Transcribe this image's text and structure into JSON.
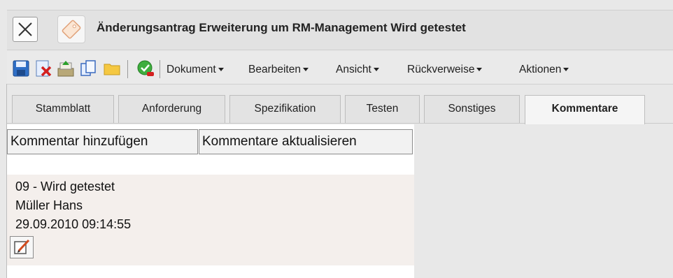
{
  "window": {
    "title": "Änderungsantrag Erweiterung um RM-Management Wird getestet",
    "close_icon": "close-icon",
    "document_icon": "tag-icon"
  },
  "toolbar": {
    "icons": [
      "save-icon",
      "delete-icon",
      "export-icon",
      "copy-icon",
      "folder-icon",
      "approve-icon"
    ],
    "menus": [
      {
        "label": "Dokument"
      },
      {
        "label": "Bearbeiten"
      },
      {
        "label": "Ansicht"
      },
      {
        "label": "Rückverweise"
      },
      {
        "label": "Aktionen"
      }
    ]
  },
  "tabs": [
    {
      "label": "Stammblatt",
      "active": false
    },
    {
      "label": "Anforderung",
      "active": false
    },
    {
      "label": "Spezifikation",
      "active": false
    },
    {
      "label": "Testen",
      "active": false
    },
    {
      "label": "Sonstiges",
      "active": false
    },
    {
      "label": "Kommentare",
      "active": true
    }
  ],
  "actions": {
    "add_comment": "Kommentar hinzufügen",
    "refresh_comments": "Kommentare aktualisieren"
  },
  "comment": {
    "status": "09 - Wird getestet",
    "author": "Müller Hans",
    "timestamp": "29.09.2010 09:14:55",
    "edit_icon": "edit-icon"
  },
  "colors": {
    "window_bg": "#e8e8e8",
    "comment_bg": "#f4efec",
    "active_tab_bg": "#f5f5f5"
  }
}
